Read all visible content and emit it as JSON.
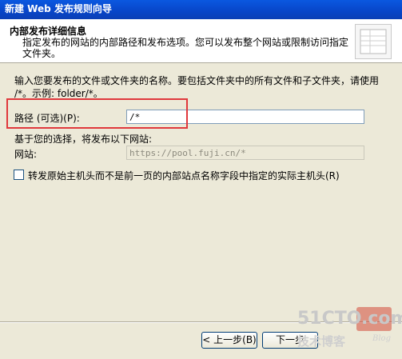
{
  "window": {
    "title": "新建 Web 发布规则向导"
  },
  "header": {
    "title": "内部发布详细信息",
    "description": "指定发布的网站的内部路径和发布选项。您可以发布整个网站或限制访问指定文件夹。",
    "icon": "wizard-banner-icon"
  },
  "body": {
    "intro": "输入您要发布的文件或文件夹的名称。要包括文件夹中的所有文件和子文件夹，请使用 /*。示例: folder/*。",
    "path_label": "路径 (可选)(P):",
    "path_value": "/*",
    "based_on_label": "基于您的选择，将发布以下网站:",
    "website_label": "网站:",
    "website_value": "https://pool.fuji.cn/*",
    "forward_host_label": "转发原始主机头而不是前一页的内部站点名称字段中指定的实际主机头(R)",
    "forward_host_checked": false
  },
  "buttons": {
    "back": "< 上一步(B)",
    "next": "下一步"
  },
  "watermark": {
    "site": "51CTO.com",
    "sub": "技术博客",
    "blog": "Blog"
  },
  "colors": {
    "titlebar": "#0a58e0",
    "dialog_bg": "#ece9d8",
    "highlight": "#e0383c"
  }
}
